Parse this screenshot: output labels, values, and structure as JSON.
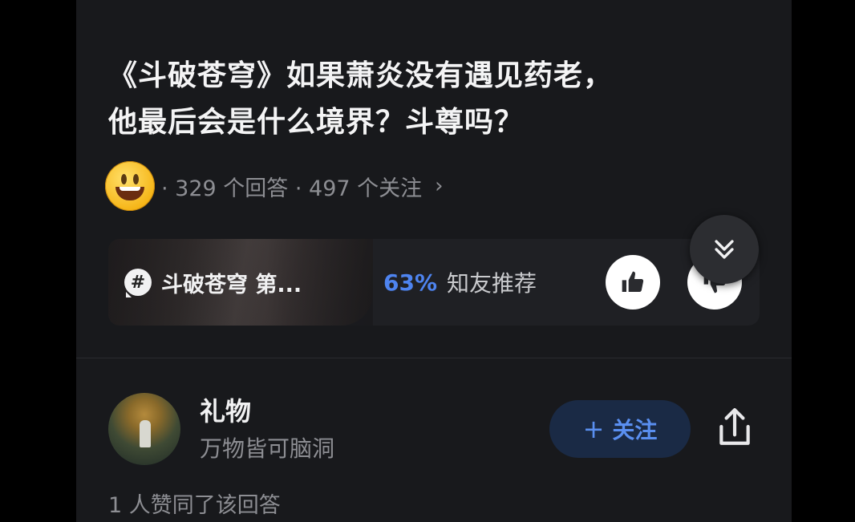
{
  "question": {
    "title_line1": "《斗破苍穹》如果萧炎没有遇见药老，",
    "title_line2": "他最后会是什么境界？斗尊吗？",
    "meta": "· 329 个回答 · 497 个关注",
    "meta_chevron": "›",
    "avatar_icon": "smiley-emoji-icon"
  },
  "topic_card": {
    "topic_label": "斗破苍穹 第...",
    "hash_symbol": "#",
    "recommend_pct": "63%",
    "recommend_text": "知友推荐"
  },
  "answer": {
    "author_name": "礼物",
    "author_bio": "万物皆可脑洞",
    "follow_label": "关注",
    "follow_plus": "+",
    "upvote_text": "1 人赞同了该回答"
  },
  "colors": {
    "background": "#18191c",
    "accent_blue": "#4e84f0",
    "follow_bg": "#1a2a45"
  }
}
